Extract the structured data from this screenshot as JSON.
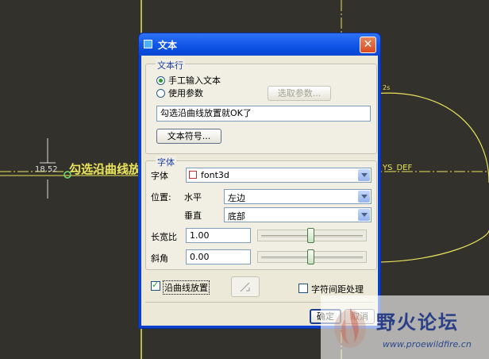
{
  "cad": {
    "dimension_value": "18.52",
    "text_on_curve": "勾选沿曲线放置就OK了",
    "ref_label": "YS_DEF",
    "small_label": "2s"
  },
  "dialog": {
    "title": "文本",
    "close_icon": "close-icon",
    "text_group": {
      "label": "文本行",
      "radio_manual": "手工输入文本",
      "radio_param": "使用参数",
      "radio_selected": "manual",
      "select_param_button": "选取参数...",
      "text_value": "勾选沿曲线放置就OK了",
      "symbol_button": "文本符号..."
    },
    "font_group": {
      "label": "字体",
      "font_label": "字体",
      "font_value": "font3d",
      "position_label": "位置:",
      "horizontal_label": "水平",
      "horizontal_value": "左边",
      "vertical_label": "垂直",
      "vertical_value": "底部",
      "aspect_label": "长宽比",
      "aspect_value": "1.00",
      "aspect_slider_level": 0.49,
      "slant_label": "斜角",
      "slant_value": "0.00",
      "slant_slider_level": 0.49
    },
    "place_on_curve_label": "沿曲线放置",
    "place_on_curve_checked": true,
    "char_spacing_label": "字符间距处理",
    "char_spacing_checked": false,
    "ok_button": "确定",
    "cancel_button": "取消"
  },
  "watermark": {
    "title": "野火论坛",
    "url": "www.proewildfire.cn"
  },
  "colors": {
    "cad_background": "#33312c",
    "cad_yellow": "#e8e35a",
    "titlebar_blue": "#0d53e6",
    "dialog_face": "#ece9d8"
  }
}
